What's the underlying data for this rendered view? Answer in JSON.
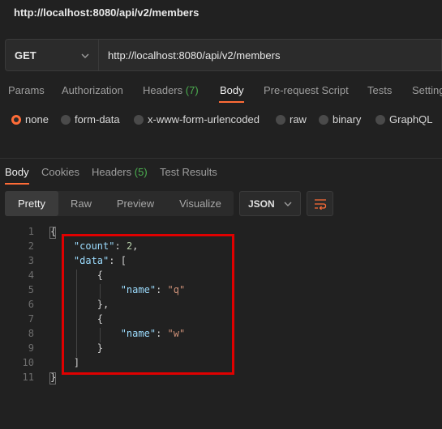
{
  "window": {
    "title": "http://localhost:8080/api/v2/members"
  },
  "request": {
    "method": "GET",
    "url": "http://localhost:8080/api/v2/members"
  },
  "request_tabs": [
    {
      "label": "Params"
    },
    {
      "label": "Authorization"
    },
    {
      "label": "Headers",
      "count": "(7)"
    },
    {
      "label": "Body",
      "active": true
    },
    {
      "label": "Pre-request Script"
    },
    {
      "label": "Tests"
    },
    {
      "label": "Settings"
    }
  ],
  "body_types": [
    {
      "label": "none",
      "selected": true
    },
    {
      "label": "form-data"
    },
    {
      "label": "x-www-form-urlencoded"
    },
    {
      "label": "raw"
    },
    {
      "label": "binary"
    },
    {
      "label": "GraphQL"
    }
  ],
  "response_tabs": [
    {
      "label": "Body",
      "active": true
    },
    {
      "label": "Cookies"
    },
    {
      "label": "Headers",
      "count": "(5)"
    },
    {
      "label": "Test Results"
    }
  ],
  "view_modes": [
    {
      "label": "Pretty",
      "active": true
    },
    {
      "label": "Raw"
    },
    {
      "label": "Preview"
    },
    {
      "label": "Visualize"
    }
  ],
  "format": {
    "selected": "JSON"
  },
  "response_body": {
    "line_numbers": [
      "1",
      "2",
      "3",
      "4",
      "5",
      "6",
      "7",
      "8",
      "9",
      "10",
      "11"
    ],
    "lines": [
      {
        "tokens": [
          {
            "t": "{",
            "c": "punct"
          }
        ]
      },
      {
        "tokens": [
          {
            "t": "    "
          },
          {
            "t": "\"count\"",
            "c": "key"
          },
          {
            "t": ": ",
            "c": "punct"
          },
          {
            "t": "2",
            "c": "num"
          },
          {
            "t": ",",
            "c": "punct"
          }
        ]
      },
      {
        "tokens": [
          {
            "t": "    "
          },
          {
            "t": "\"data\"",
            "c": "key"
          },
          {
            "t": ": [",
            "c": "punct"
          }
        ]
      },
      {
        "tokens": [
          {
            "t": "        "
          },
          {
            "t": "{",
            "c": "punct"
          }
        ]
      },
      {
        "tokens": [
          {
            "t": "            "
          },
          {
            "t": "\"name\"",
            "c": "key"
          },
          {
            "t": ": ",
            "c": "punct"
          },
          {
            "t": "\"q\"",
            "c": "str"
          }
        ]
      },
      {
        "tokens": [
          {
            "t": "        "
          },
          {
            "t": "},",
            "c": "punct"
          }
        ]
      },
      {
        "tokens": [
          {
            "t": "        "
          },
          {
            "t": "{",
            "c": "punct"
          }
        ]
      },
      {
        "tokens": [
          {
            "t": "            "
          },
          {
            "t": "\"name\"",
            "c": "key"
          },
          {
            "t": ": ",
            "c": "punct"
          },
          {
            "t": "\"w\"",
            "c": "str"
          }
        ]
      },
      {
        "tokens": [
          {
            "t": "        "
          },
          {
            "t": "}",
            "c": "punct"
          }
        ]
      },
      {
        "tokens": [
          {
            "t": "    "
          },
          {
            "t": "]",
            "c": "punct"
          }
        ]
      },
      {
        "tokens": [
          {
            "t": "}",
            "c": "punct"
          }
        ]
      }
    ]
  },
  "colors": {
    "accent": "#ff6c37",
    "count_green": "#4caf50",
    "highlight_red": "#e00000",
    "json_key": "#9cdcfe",
    "json_number": "#b5cea8",
    "json_string": "#ce9178"
  },
  "icons": {
    "method_dropdown": "chevron-down-icon",
    "format_dropdown": "chevron-down-icon",
    "wrap": "wrap-lines-icon"
  }
}
